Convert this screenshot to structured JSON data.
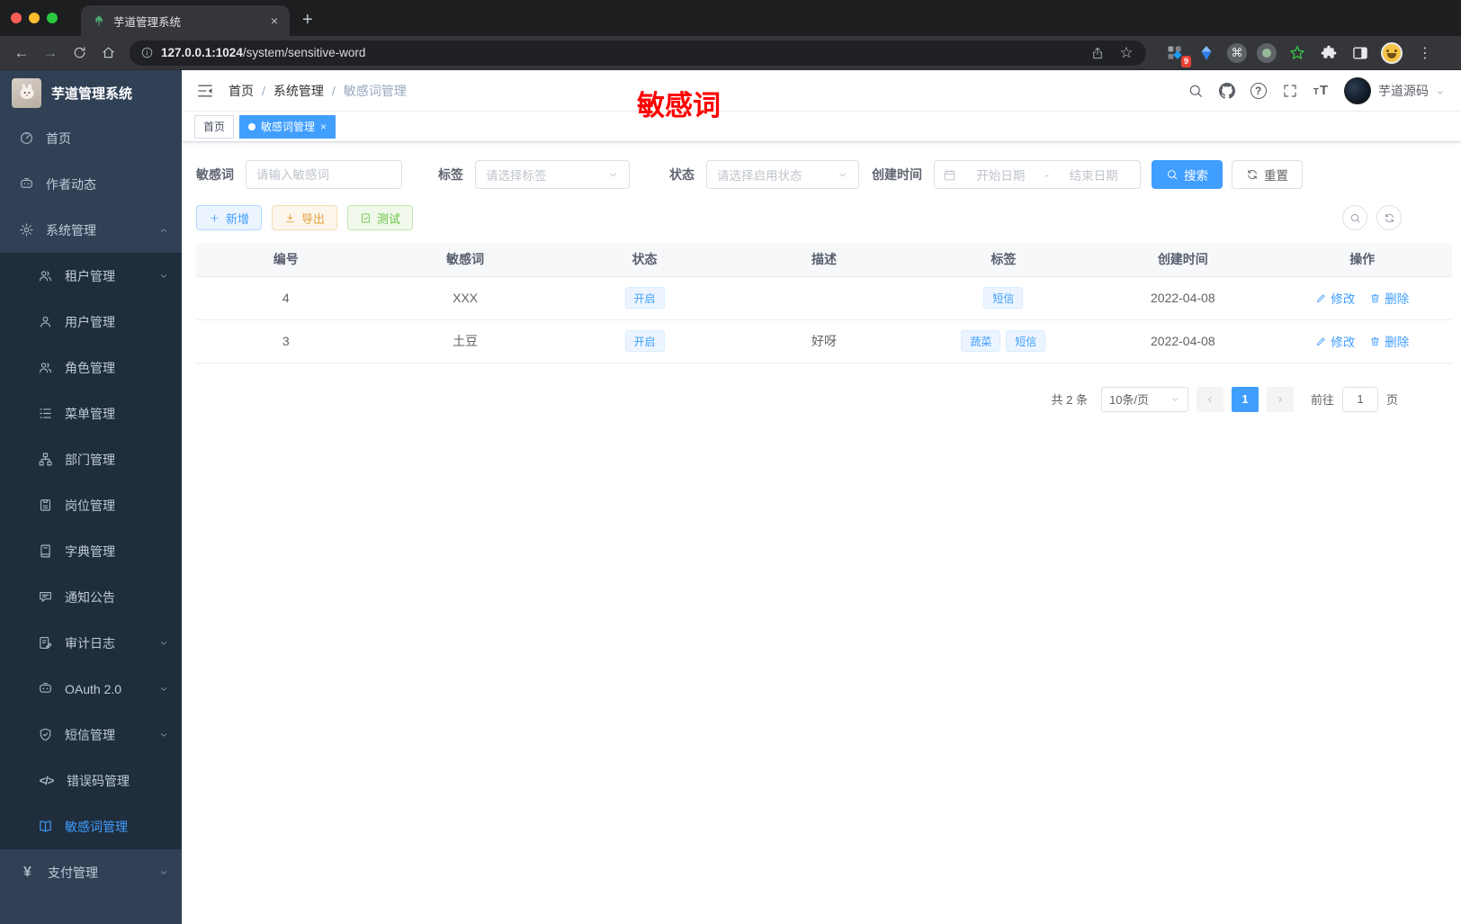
{
  "browser": {
    "tab_title": "芋道管理系统",
    "new_tab": "+",
    "url_host": "127.0.0.1:1024",
    "url_path": "/system/sensitive-word",
    "ext_badge": "9"
  },
  "colors": {
    "accent": "#409eff",
    "annotation_red": "#ff0000",
    "sidebar_bg": "#304156",
    "submenu_bg": "#1f2d3d",
    "tag_blue_bg": "#ecf5ff"
  },
  "sidebar": {
    "title": "芋道管理系统",
    "items": [
      {
        "label": "首页",
        "icon": "dashboard",
        "level": 1
      },
      {
        "label": "作者动态",
        "icon": "chat",
        "level": 1
      },
      {
        "label": "系统管理",
        "icon": "gear",
        "level": 1,
        "chevron": "up"
      },
      {
        "label": "租户管理",
        "icon": "users",
        "level": 2,
        "chevron": "down"
      },
      {
        "label": "用户管理",
        "icon": "user",
        "level": 2
      },
      {
        "label": "角色管理",
        "icon": "users",
        "level": 2
      },
      {
        "label": "菜单管理",
        "icon": "list",
        "level": 2
      },
      {
        "label": "部门管理",
        "icon": "org",
        "level": 2
      },
      {
        "label": "岗位管理",
        "icon": "card",
        "level": 2
      },
      {
        "label": "字典管理",
        "icon": "dict",
        "level": 2
      },
      {
        "label": "通知公告",
        "icon": "notice",
        "level": 2
      },
      {
        "label": "审计日志",
        "icon": "audit",
        "level": 2,
        "chevron": "down"
      },
      {
        "label": "OAuth 2.0",
        "icon": "chat",
        "level": 2,
        "chevron": "down"
      },
      {
        "label": "短信管理",
        "icon": "shield",
        "level": 2,
        "chevron": "down"
      },
      {
        "label": "错误码管理",
        "icon": "code",
        "level": 2
      },
      {
        "label": "敏感词管理",
        "icon": "openbook",
        "level": 2,
        "active": true
      },
      {
        "label": "支付管理",
        "icon": "yen",
        "level": 1,
        "chevron": "down"
      }
    ]
  },
  "header": {
    "breadcrumb": [
      "首页",
      "系统管理",
      "敏感词管理"
    ],
    "separator": "/",
    "annotation": "敏感词",
    "user_name": "芋道源码"
  },
  "tags": {
    "items": [
      {
        "label": "首页",
        "active": false
      },
      {
        "label": "敏感词管理",
        "active": true,
        "closable": true
      }
    ],
    "close_glyph": "×"
  },
  "filters": {
    "keyword": {
      "label": "敏感词",
      "placeholder": "请输入敏感词"
    },
    "tag": {
      "label": "标签",
      "placeholder": "请选择标签"
    },
    "status": {
      "label": "状态",
      "placeholder": "请选择启用状态"
    },
    "create_time": {
      "label": "创建时间",
      "start_placeholder": "开始日期",
      "separator": "-",
      "end_placeholder": "结束日期"
    },
    "search_label": "搜索",
    "reset_label": "重置"
  },
  "toolbar": {
    "add_label": "新增",
    "export_label": "导出",
    "test_label": "测试"
  },
  "table": {
    "columns": [
      "编号",
      "敏感词",
      "状态",
      "描述",
      "标签",
      "创建时间",
      "操作"
    ],
    "rows": [
      {
        "id": "4",
        "word": "XXX",
        "status": "开启",
        "desc": "",
        "tags": [
          "短信"
        ],
        "created": "2022-04-08"
      },
      {
        "id": "3",
        "word": "土豆",
        "status": "开启",
        "desc": "好呀",
        "tags": [
          "蔬菜",
          "短信"
        ],
        "created": "2022-04-08"
      }
    ],
    "edit_label": "修改",
    "delete_label": "删除"
  },
  "pagination": {
    "total": "共 2 条",
    "page_size": "10条/页",
    "prev": "‹",
    "current_page": "1",
    "next": "›",
    "goto_label": "前往",
    "goto_value": "1",
    "unit_label": "页"
  }
}
